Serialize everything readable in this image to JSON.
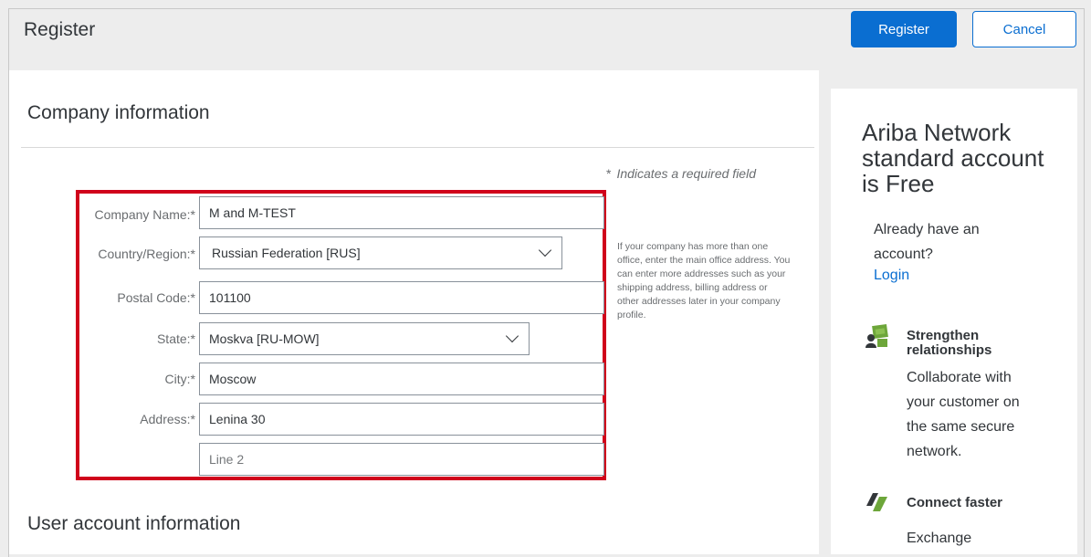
{
  "header": {
    "title": "Register",
    "register_label": "Register",
    "cancel_label": "Cancel"
  },
  "company_section": {
    "title": "Company information",
    "required_note": "Indicates a required field",
    "required_star": "*",
    "fields": [
      {
        "label": "Company Name:*",
        "value": "M and M-TEST"
      },
      {
        "label": "Country/Region:*",
        "value": "Russian Federation  [RUS]"
      },
      {
        "label": "Postal Code:*",
        "value": "101100"
      },
      {
        "label": "State:*",
        "value": "Moskva  [RU-MOW]"
      },
      {
        "label": "City:*",
        "value": "Moscow"
      },
      {
        "label": "Address:*",
        "value": "Lenina 30"
      }
    ],
    "address_line2_placeholder": "Line 2",
    "help_text": "If your company has more than one office, enter the main office address. You can enter more addresses such as your shipping address, billing address or other addresses later in your company profile."
  },
  "user_section": {
    "title": "User account information"
  },
  "side_panel": {
    "headline": "Ariba Network standard account is Free",
    "already_have": "Already have an account?",
    "login_label": "Login",
    "benefits": [
      {
        "icon": "people-box-icon",
        "title": "Strengthen relationships",
        "desc": "Collaborate with your customer on the same secure network."
      },
      {
        "icon": "connect-arrows-icon",
        "title": "Connect faster",
        "desc": "Exchange"
      }
    ]
  },
  "colors": {
    "primary": "#0a6ed1",
    "highlight": "#d0021b",
    "icon_green": "#6da63a"
  }
}
